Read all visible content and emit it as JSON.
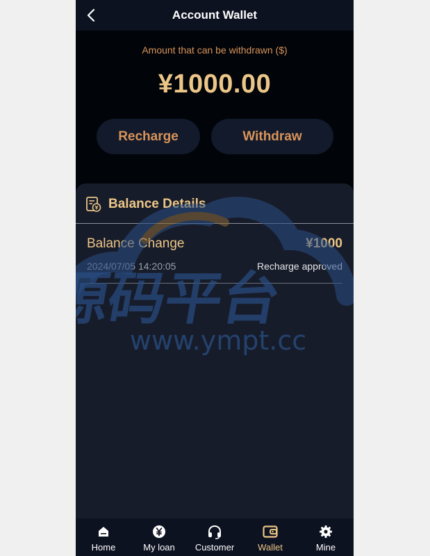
{
  "header": {
    "title": "Account Wallet"
  },
  "wallet": {
    "amount_label": "Amount that can be withdrawn ($)",
    "amount_value": "¥1000.00",
    "recharge_label": "Recharge",
    "withdraw_label": "Withdraw"
  },
  "details": {
    "title": "Balance Details",
    "records": [
      {
        "label": "Balance Change",
        "amount": "¥1000",
        "time": "2024/07/05 14:20:05",
        "status": "Recharge approved"
      }
    ]
  },
  "watermark": {
    "text_cn": "源码平台",
    "text_url": "www.ympt.cc"
  },
  "tabbar": {
    "items": [
      {
        "label": "Home",
        "icon": "home-icon"
      },
      {
        "label": "My loan",
        "icon": "yen-coin-icon"
      },
      {
        "label": "Customer",
        "icon": "headset-icon"
      },
      {
        "label": "Wallet",
        "icon": "wallet-icon"
      },
      {
        "label": "Mine",
        "icon": "gear-icon"
      }
    ],
    "active_index": 3
  },
  "colors": {
    "accent_gold": "#ecc688",
    "accent_orange": "#d9945a",
    "background": "#010409",
    "card": "#171c2a",
    "bar": "#0d1220"
  }
}
